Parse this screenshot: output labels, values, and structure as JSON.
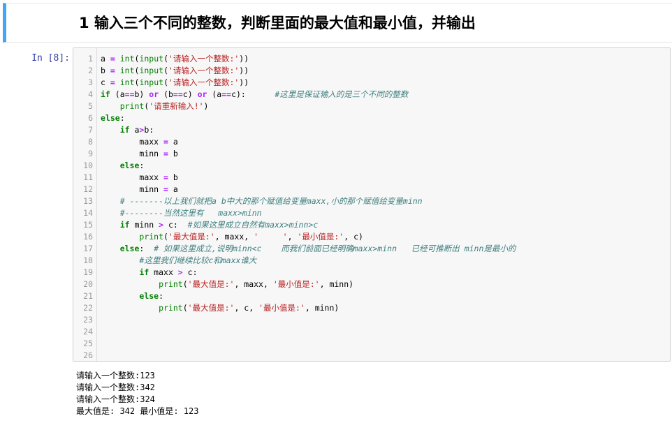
{
  "heading": {
    "text": "1  输入三个不同的整数，判断里面的最大值和最小值，并输出"
  },
  "cell": {
    "prompt": "In  [8]:",
    "code": [
      {
        "n": "1",
        "tokens": [
          [
            "var",
            "a "
          ],
          [
            "op",
            "="
          ],
          [
            "sp",
            " "
          ],
          [
            "bi",
            "int"
          ],
          [
            "punc",
            "("
          ],
          [
            "bi",
            "input"
          ],
          [
            "punc",
            "("
          ],
          [
            "str",
            "'请输入一个整数:'"
          ],
          [
            "punc",
            "))"
          ]
        ]
      },
      {
        "n": "2",
        "tokens": [
          [
            "var",
            "b "
          ],
          [
            "op",
            "="
          ],
          [
            "sp",
            " "
          ],
          [
            "bi",
            "int"
          ],
          [
            "punc",
            "("
          ],
          [
            "bi",
            "input"
          ],
          [
            "punc",
            "("
          ],
          [
            "str",
            "'请输入一个整数:'"
          ],
          [
            "punc",
            "))"
          ]
        ]
      },
      {
        "n": "3",
        "tokens": [
          [
            "var",
            "c "
          ],
          [
            "op",
            "="
          ],
          [
            "sp",
            " "
          ],
          [
            "bi",
            "int"
          ],
          [
            "punc",
            "("
          ],
          [
            "bi",
            "input"
          ],
          [
            "punc",
            "("
          ],
          [
            "str",
            "'请输入一个整数:'"
          ],
          [
            "punc",
            "))"
          ]
        ]
      },
      {
        "n": "4",
        "tokens": [
          [
            "kw",
            "if"
          ],
          [
            "punc",
            " (a"
          ],
          [
            "op",
            "=="
          ],
          [
            "punc",
            "b) "
          ],
          [
            "op",
            "or"
          ],
          [
            "punc",
            " (b"
          ],
          [
            "op",
            "=="
          ],
          [
            "punc",
            "c) "
          ],
          [
            "op",
            "or"
          ],
          [
            "punc",
            " (a"
          ],
          [
            "op",
            "=="
          ],
          [
            "punc",
            "c):      "
          ],
          [
            "cmt",
            "#这里是保证输入的是三个不同的整数"
          ]
        ]
      },
      {
        "n": "5",
        "tokens": [
          [
            "sp",
            "    "
          ],
          [
            "bi",
            "print"
          ],
          [
            "punc",
            "("
          ],
          [
            "str",
            "'请重新输入!'"
          ],
          [
            "punc",
            ")"
          ]
        ]
      },
      {
        "n": "6",
        "tokens": [
          [
            "kw",
            "else"
          ],
          [
            "punc",
            ":"
          ]
        ]
      },
      {
        "n": "7",
        "tokens": [
          [
            "sp",
            "    "
          ],
          [
            "kw",
            "if"
          ],
          [
            "punc",
            " a"
          ],
          [
            "op",
            ">"
          ],
          [
            "punc",
            "b:"
          ]
        ]
      },
      {
        "n": "8",
        "tokens": [
          [
            "sp",
            "        "
          ],
          [
            "var",
            "maxx "
          ],
          [
            "op",
            "="
          ],
          [
            "punc",
            " a"
          ]
        ]
      },
      {
        "n": "9",
        "tokens": [
          [
            "sp",
            "        "
          ],
          [
            "var",
            "minn "
          ],
          [
            "op",
            "="
          ],
          [
            "punc",
            " b"
          ]
        ]
      },
      {
        "n": "10",
        "tokens": [
          [
            "sp",
            "    "
          ],
          [
            "kw",
            "else"
          ],
          [
            "punc",
            ":"
          ]
        ]
      },
      {
        "n": "11",
        "tokens": [
          [
            "sp",
            "        "
          ],
          [
            "var",
            "maxx "
          ],
          [
            "op",
            "="
          ],
          [
            "punc",
            " b"
          ]
        ]
      },
      {
        "n": "12",
        "tokens": [
          [
            "sp",
            "        "
          ],
          [
            "var",
            "minn "
          ],
          [
            "op",
            "="
          ],
          [
            "punc",
            " a"
          ]
        ]
      },
      {
        "n": "13",
        "tokens": [
          [
            "sp",
            "    "
          ],
          [
            "cmt",
            "# -------以上我们就把a b中大的那个赋值给变量maxx,小的那个赋值给变量minn"
          ]
        ]
      },
      {
        "n": "14",
        "tokens": [
          [
            "sp",
            "    "
          ],
          [
            "cmt",
            "#--------当然这里有   maxx>minn"
          ]
        ]
      },
      {
        "n": "15",
        "tokens": [
          [
            "sp",
            "    "
          ],
          [
            "kw",
            "if"
          ],
          [
            "punc",
            " minn "
          ],
          [
            "op",
            ">"
          ],
          [
            "punc",
            " c:  "
          ],
          [
            "cmt",
            "#如果这里成立自然有maxx>minn>c"
          ]
        ]
      },
      {
        "n": "16",
        "tokens": [
          [
            "sp",
            "        "
          ],
          [
            "bi",
            "print"
          ],
          [
            "punc",
            "("
          ],
          [
            "str",
            "'最大值是:'"
          ],
          [
            "punc",
            ", maxx, "
          ],
          [
            "str",
            "'     '"
          ],
          [
            "punc",
            ", "
          ],
          [
            "str",
            "'最小值是:'"
          ],
          [
            "punc",
            ", c)"
          ]
        ]
      },
      {
        "n": "17",
        "tokens": [
          [
            "sp",
            "    "
          ],
          [
            "kw",
            "else"
          ],
          [
            "punc",
            ":  "
          ],
          [
            "cmt",
            "# 如果这里成立,说明minn<c    而我们前面已经明确maxx>minn   已经可推断出 minn是最小的"
          ]
        ]
      },
      {
        "n": "18",
        "tokens": [
          [
            "sp",
            "        "
          ],
          [
            "cmt",
            "#这里我们继续比较c和maxx谁大"
          ]
        ]
      },
      {
        "n": "19",
        "tokens": [
          [
            "sp",
            "        "
          ],
          [
            "kw",
            "if"
          ],
          [
            "punc",
            " maxx "
          ],
          [
            "op",
            ">"
          ],
          [
            "punc",
            " c:"
          ]
        ]
      },
      {
        "n": "20",
        "tokens": [
          [
            "sp",
            "            "
          ],
          [
            "bi",
            "print"
          ],
          [
            "punc",
            "("
          ],
          [
            "str",
            "'最大值是:'"
          ],
          [
            "punc",
            ", maxx, "
          ],
          [
            "str",
            "'最小值是:'"
          ],
          [
            "punc",
            ", minn)"
          ]
        ]
      },
      {
        "n": "21",
        "tokens": [
          [
            "sp",
            "        "
          ],
          [
            "kw",
            "else"
          ],
          [
            "punc",
            ":"
          ]
        ]
      },
      {
        "n": "22",
        "tokens": [
          [
            "sp",
            "            "
          ],
          [
            "bi",
            "print"
          ],
          [
            "punc",
            "("
          ],
          [
            "str",
            "'最大值是:'"
          ],
          [
            "punc",
            ", c, "
          ],
          [
            "str",
            "'最小值是:'"
          ],
          [
            "punc",
            ", minn)"
          ]
        ]
      },
      {
        "n": "23",
        "tokens": []
      },
      {
        "n": "24",
        "tokens": []
      },
      {
        "n": "25",
        "tokens": []
      },
      {
        "n": "26",
        "tokens": []
      }
    ]
  },
  "output": {
    "lines": [
      "请输入一个整数:123",
      "请输入一个整数:342",
      "请输入一个整数:324",
      "最大值是: 342 最小值是: 123"
    ]
  }
}
